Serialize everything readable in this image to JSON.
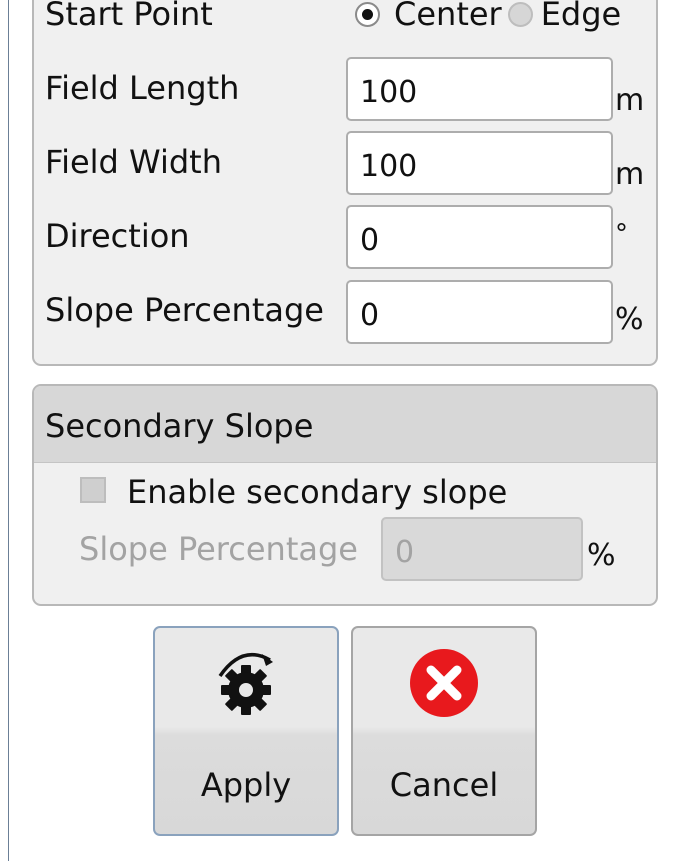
{
  "settings": {
    "start_point": {
      "label": "Start Point",
      "options": [
        "Center",
        "Edge"
      ],
      "selected": "Center"
    },
    "field_length": {
      "label": "Field Length",
      "value": "100",
      "unit": "m"
    },
    "field_width": {
      "label": "Field Width",
      "value": "100",
      "unit": "m"
    },
    "direction": {
      "label": "Direction",
      "value": "0",
      "unit": "°"
    },
    "slope_percentage": {
      "label": "Slope Percentage",
      "value": "0",
      "unit": "%"
    }
  },
  "secondary_slope": {
    "title": "Secondary Slope",
    "enable_label": "Enable secondary slope",
    "enabled": false,
    "slope_label": "Slope Percentage",
    "slope_value": "0",
    "slope_unit": "%"
  },
  "actions": {
    "apply_label": "Apply",
    "cancel_label": "Cancel",
    "apply_icon": "gear-rotate-icon",
    "cancel_icon": "red-x-circle-icon"
  },
  "colors": {
    "cancel_red": "#e8191d",
    "panel_bg": "#f0f0f0",
    "header_bg": "#d7d7d7"
  }
}
